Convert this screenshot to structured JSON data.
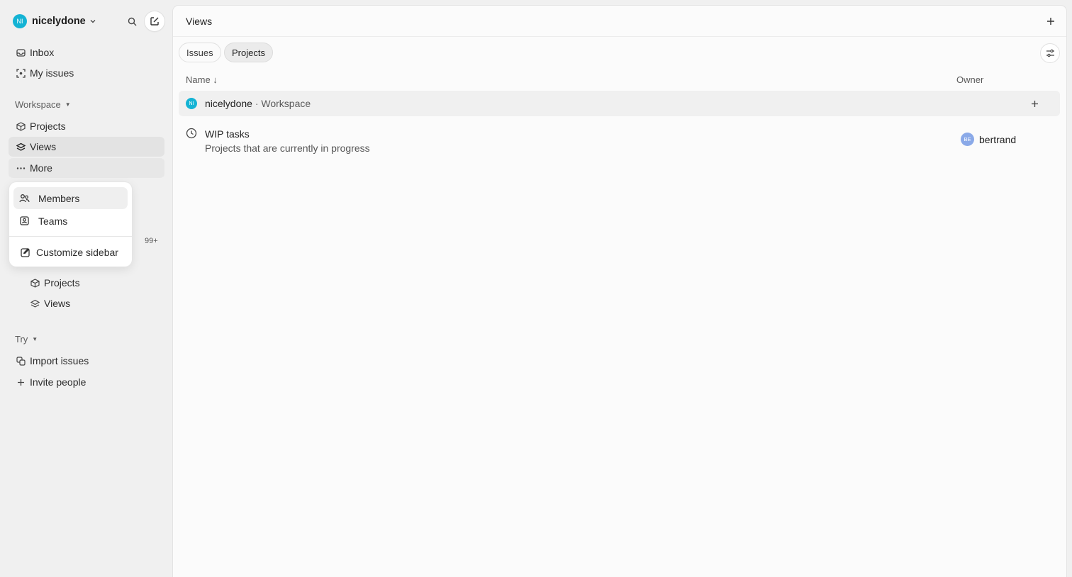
{
  "workspace": {
    "initials": "NI",
    "name": "nicelydone",
    "avatar_color": "#14b3d4"
  },
  "sidebar": {
    "inbox": "Inbox",
    "my_issues": "My issues",
    "workspace_label": "Workspace",
    "projects": "Projects",
    "views": "Views",
    "more": "More",
    "badge": "99+",
    "team_projects": "Projects",
    "team_views": "Views",
    "try_label": "Try",
    "import_issues": "Import issues",
    "invite_people": "Invite people"
  },
  "more_menu": {
    "members": "Members",
    "teams": "Teams",
    "customize": "Customize sidebar"
  },
  "main": {
    "title": "Views",
    "add": "+",
    "tabs": [
      {
        "label": "Issues"
      },
      {
        "label": "Projects"
      }
    ],
    "columns": {
      "name": "Name ↓",
      "owner": "Owner"
    },
    "group": {
      "initials": "NI",
      "name": "nicelydone",
      "sep": " · ",
      "kind": "Workspace",
      "add": "+"
    },
    "rows": [
      {
        "title": "WIP tasks",
        "description": "Projects that are currently in progress",
        "owner_initials": "BE",
        "owner": "bertrand"
      }
    ]
  }
}
